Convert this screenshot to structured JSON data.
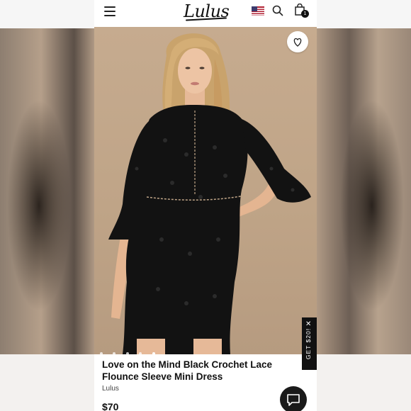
{
  "header": {
    "logo": "Lulus",
    "cart_count": "1"
  },
  "gallery": {
    "dot_count": 5,
    "active_index": 4
  },
  "promo": {
    "label": "GET $20!",
    "close": "✕"
  },
  "product": {
    "title": "Love on the Mind Black Crochet Lace Flounce Sleeve Mini Dress",
    "brand": "Lulus",
    "price": "$70"
  },
  "colors": {
    "dress": "#121212",
    "photo_bg": "#c2a68a",
    "accent": "#111111"
  }
}
